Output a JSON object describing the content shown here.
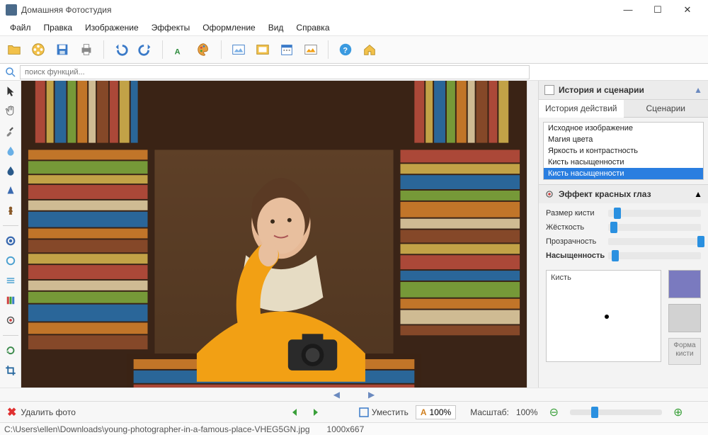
{
  "app": {
    "title": "Домашняя Фотостудия"
  },
  "menu": [
    "Файл",
    "Правка",
    "Изображение",
    "Эффекты",
    "Оформление",
    "Вид",
    "Справка"
  ],
  "toolbar_icons": [
    "open-folder",
    "film-reel",
    "save",
    "print",
    "sep",
    "undo",
    "redo",
    "sep",
    "text-a",
    "palette",
    "sep",
    "image-import",
    "image-frame",
    "calendar",
    "image-color",
    "sep",
    "help",
    "home"
  ],
  "search": {
    "placeholder": "поиск функций..."
  },
  "left_tools": [
    "cursor",
    "hand",
    "eyedropper",
    "drop",
    "drop-dark",
    "cone",
    "chess-piece",
    "sep",
    "hue-ring",
    "circle-outline",
    "lines",
    "rgb-bars",
    "redeye-remove",
    "sep",
    "rotate",
    "crop"
  ],
  "right": {
    "history_title": "История и сценарии",
    "tabs": {
      "active": "История действий",
      "other": "Сценарии"
    },
    "history_items": [
      {
        "label": "Исходное изображение",
        "selected": false
      },
      {
        "label": "Магия цвета",
        "selected": false
      },
      {
        "label": "Яркость и контрастность",
        "selected": false
      },
      {
        "label": "Кисть насыщенности",
        "selected": false
      },
      {
        "label": "Кисть насыщенности",
        "selected": true
      }
    ],
    "effect_title": "Эффект красных глаз",
    "sliders": [
      {
        "label": "Размер кисти",
        "pos": 6,
        "bold": false
      },
      {
        "label": "Жёсткость",
        "pos": 2,
        "bold": false
      },
      {
        "label": "Прозрачность",
        "pos": 96,
        "bold": false
      },
      {
        "label": "Насыщенность",
        "pos": 4,
        "bold": true
      }
    ],
    "brush_label": "Кисть",
    "shape_btn": "Форма кисти"
  },
  "bottom": {
    "delete": "Удалить фото",
    "fit": "Уместить",
    "zoom_box": "100%",
    "scale_label": "Масштаб:",
    "scale_value": "100%"
  },
  "status": {
    "path": "C:\\Users\\ellen\\Downloads\\young-photographer-in-a-famous-place-VHEG5GN.jpg",
    "dims": "1000x667"
  }
}
